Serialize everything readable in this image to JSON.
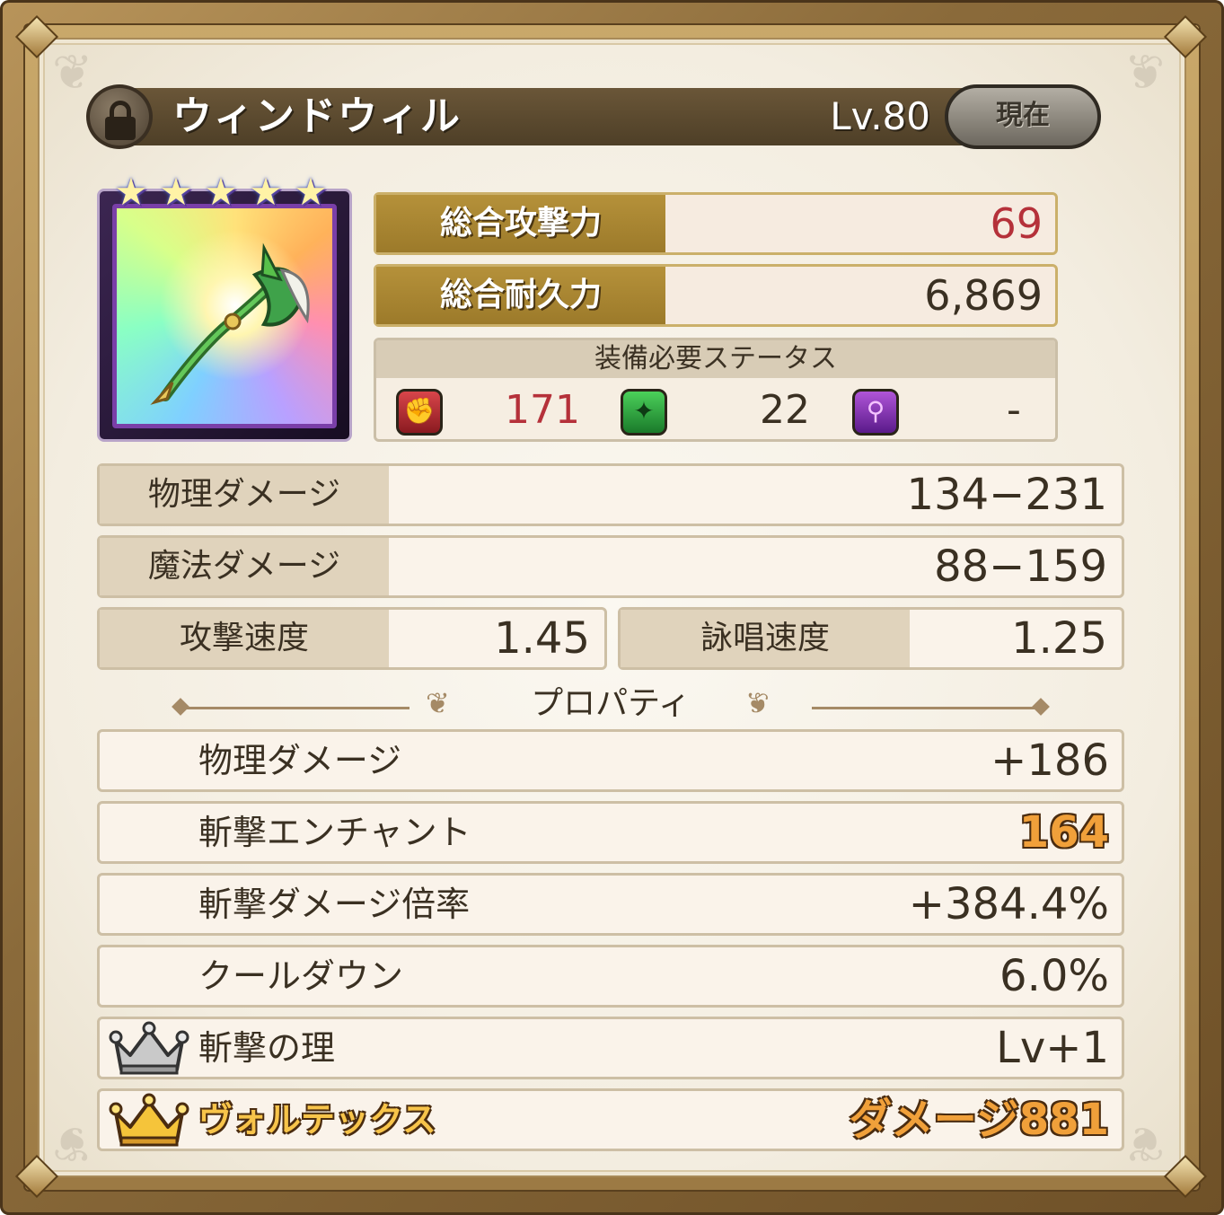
{
  "header": {
    "item_name": "ウィンドウィル",
    "level": "Lv.80",
    "current_button": "現在",
    "lock_icon": "unlocked-padlock-icon"
  },
  "card": {
    "rarity_stars": 5,
    "star_icon": "rainbow-star-icon",
    "weapon_icon": "green-axe-weapon-icon"
  },
  "totals": [
    {
      "label": "総合攻撃力",
      "value": "69",
      "color": "#b5313a"
    },
    {
      "label": "総合耐久力",
      "value": "6,869",
      "color": "#3a3022"
    }
  ],
  "requirements": {
    "title": "装備必要ステータス",
    "items": [
      {
        "icon": "strength-fist-icon",
        "value": "171",
        "color": "#b5313a"
      },
      {
        "icon": "dexterity-star-icon",
        "value": "22",
        "color": "#3a3022"
      },
      {
        "icon": "magic-wand-icon",
        "value": "-",
        "color": "#3a3022"
      }
    ]
  },
  "stats": {
    "physical_damage": {
      "label": "物理ダメージ",
      "value": "134−231"
    },
    "magic_damage": {
      "label": "魔法ダメージ",
      "value": "88−159"
    },
    "attack_speed": {
      "label": "攻撃速度",
      "value": "1.45"
    },
    "cast_speed": {
      "label": "詠唱速度",
      "value": "1.25"
    }
  },
  "properties": {
    "title": "プロパティ",
    "items": [
      {
        "label": "物理ダメージ",
        "value": "+186"
      },
      {
        "label": "斬撃エンチャント",
        "value": "164"
      },
      {
        "label": "斬撃ダメージ倍率",
        "value": "+384.4%"
      },
      {
        "label": "クールダウン",
        "value": "6.0%"
      },
      {
        "label": "斬撃の理",
        "value": "Lv+1",
        "icon": "silver-crown-icon"
      },
      {
        "label": "ヴォルテックス",
        "value": "ダメージ881",
        "icon": "gold-crown-icon"
      }
    ]
  },
  "colors": {
    "frame": "#9c7a44",
    "panel": "#f3ede0",
    "gold_label": "#9c7a2a",
    "accent_red": "#b5313a",
    "accent_orange": "#f0a03a"
  }
}
